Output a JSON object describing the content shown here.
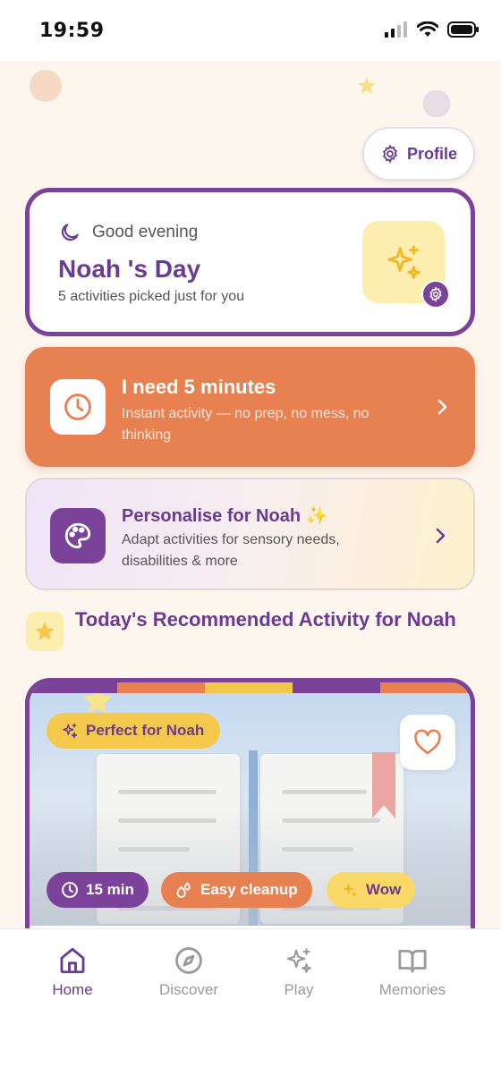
{
  "status_bar": {
    "time": "19:59"
  },
  "header": {
    "profile_label": "Profile"
  },
  "greeting": {
    "greeting_text": "Good evening",
    "title": "Noah 's Day",
    "subtitle": "5 activities picked just for you"
  },
  "quick_activity": {
    "title": "I need 5 minutes",
    "subtitle": "Instant activity — no prep, no mess, no thinking"
  },
  "personalise": {
    "title": "Personalise for Noah ✨",
    "subtitle": "Adapt activities for sensory needs, disabilities & more"
  },
  "recommended": {
    "heading": "Today's Recommended Activity for Noah",
    "badge": "Perfect for Noah",
    "chips": {
      "time": "15 min",
      "cleanup": "Easy cleanup",
      "wow": "Wow"
    }
  },
  "tabbar": {
    "items": [
      {
        "label": "Home",
        "icon": "home-icon",
        "active": true
      },
      {
        "label": "Discover",
        "icon": "compass-icon",
        "active": false
      },
      {
        "label": "Play",
        "icon": "sparkles-icon",
        "active": false
      },
      {
        "label": "Memories",
        "icon": "book-icon",
        "active": false
      }
    ]
  },
  "colors": {
    "brand_purple": "#7a4399",
    "accent_orange": "#e88152",
    "accent_yellow": "#f4c84a",
    "background": "#fdf6ee"
  }
}
